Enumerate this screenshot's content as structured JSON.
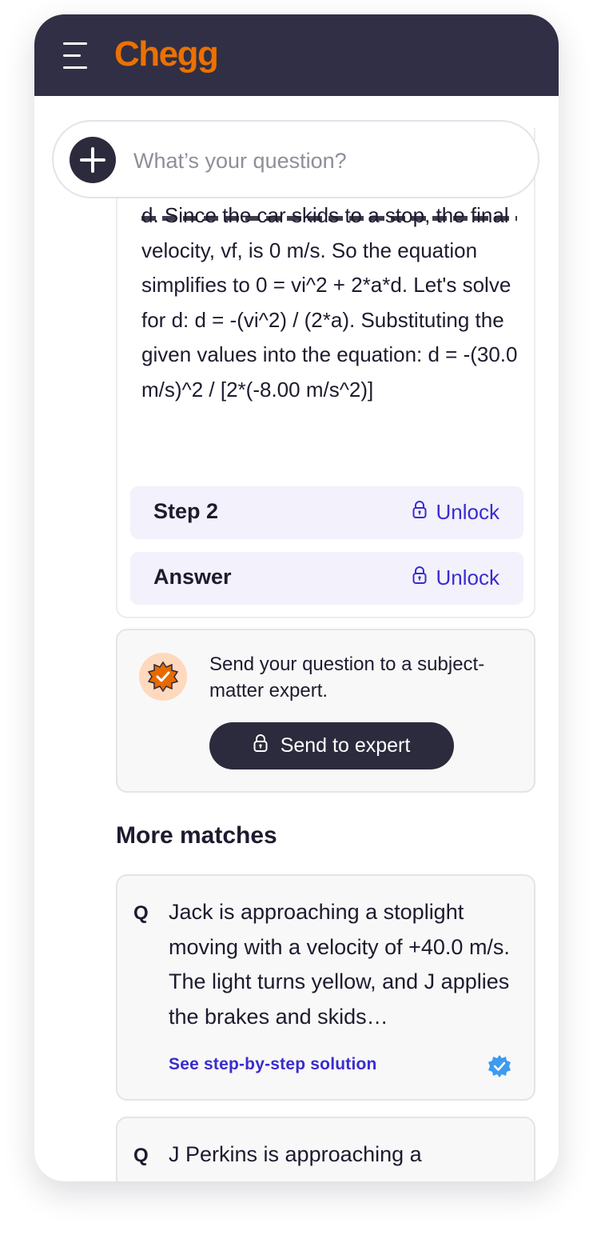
{
  "header": {
    "logo_text": "Chegg",
    "logo_color": "#eb7100",
    "background_color": "#312f45",
    "menu_icon": "hamburger-menu-icon"
  },
  "search": {
    "placeholder": "What’s your question?",
    "add_icon": "plus-icon"
  },
  "answer": {
    "step1_text": "d. Since the car skids to a stop, the final velocity, vf, is 0 m/s. So the equation simplifies to 0 = vi^2 + 2*a*d. Let's solve for d: d = -(vi^2) / (2*a). Substituting the given values into the equation: d = -(30.0 m/s)^2 / [2*(-8.00 m/s^2)]",
    "locked_sections": [
      {
        "title": "Step 2",
        "action": "Unlock",
        "icon": "lock-icon"
      },
      {
        "title": "Answer",
        "action": "Unlock",
        "icon": "lock-icon"
      }
    ],
    "accent_color": "#3b2bd0"
  },
  "expert": {
    "badge_icon": "verified-expert-badge-icon",
    "text": "Send your question to a subject-matter expert.",
    "button_label": "Send to expert",
    "button_icon": "lock-icon"
  },
  "more_matches": {
    "title": "More matches",
    "items": [
      {
        "q_label": "Q",
        "text": "Jack is approaching a stoplight moving with a velocity of +40.0 m/s. The light turns yellow, and J applies the brakes and skids…",
        "link": "See step-by-step solution",
        "badge_icon": "verified-check-icon"
      },
      {
        "q_label": "Q",
        "text": "J Perkins is approaching a"
      }
    ]
  }
}
